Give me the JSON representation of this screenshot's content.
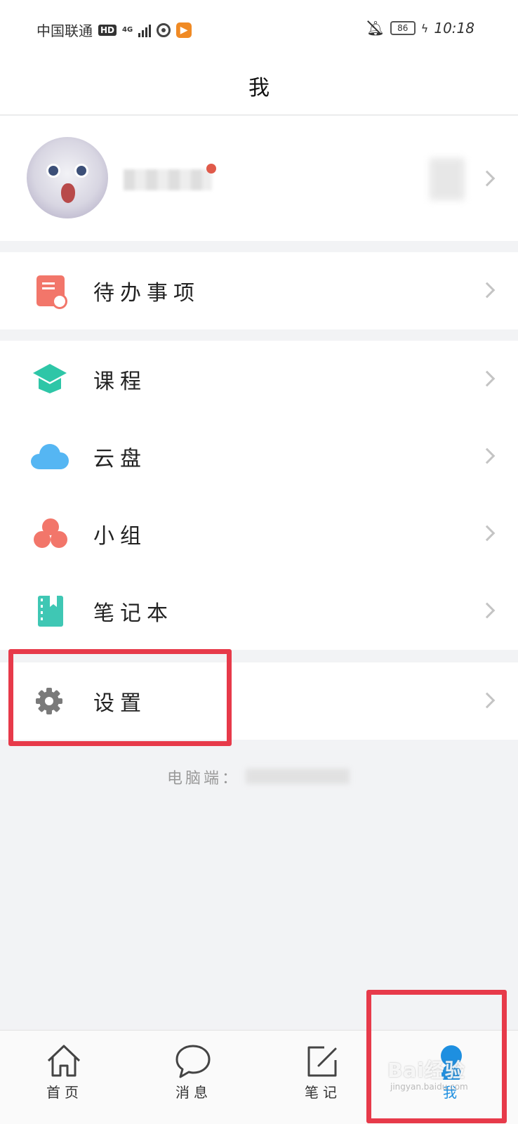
{
  "status_bar": {
    "carrier": "中国联通",
    "hd": "HD",
    "network": "4G",
    "battery": "86",
    "time": "10:18"
  },
  "header": {
    "title": "我"
  },
  "menu": {
    "todo": "待办事项",
    "course": "课程",
    "cloud": "云盘",
    "group": "小组",
    "notebook": "笔记本",
    "settings": "设置"
  },
  "pc_label": "电脑端：",
  "tabs": [
    {
      "label": "首页",
      "icon": "home-icon"
    },
    {
      "label": "消息",
      "icon": "chat-icon"
    },
    {
      "label": "笔记",
      "icon": "note-edit-icon"
    },
    {
      "label": "我",
      "icon": "profile-icon"
    }
  ],
  "watermark": "Bai经验",
  "watermark_url": "jingyan.baidu.com",
  "colors": {
    "highlight": "#e73a4a",
    "course": "#2ec6a7",
    "cloud": "#55b6f3",
    "todo": "#f2766a",
    "active_tab": "#1e8fe0"
  }
}
